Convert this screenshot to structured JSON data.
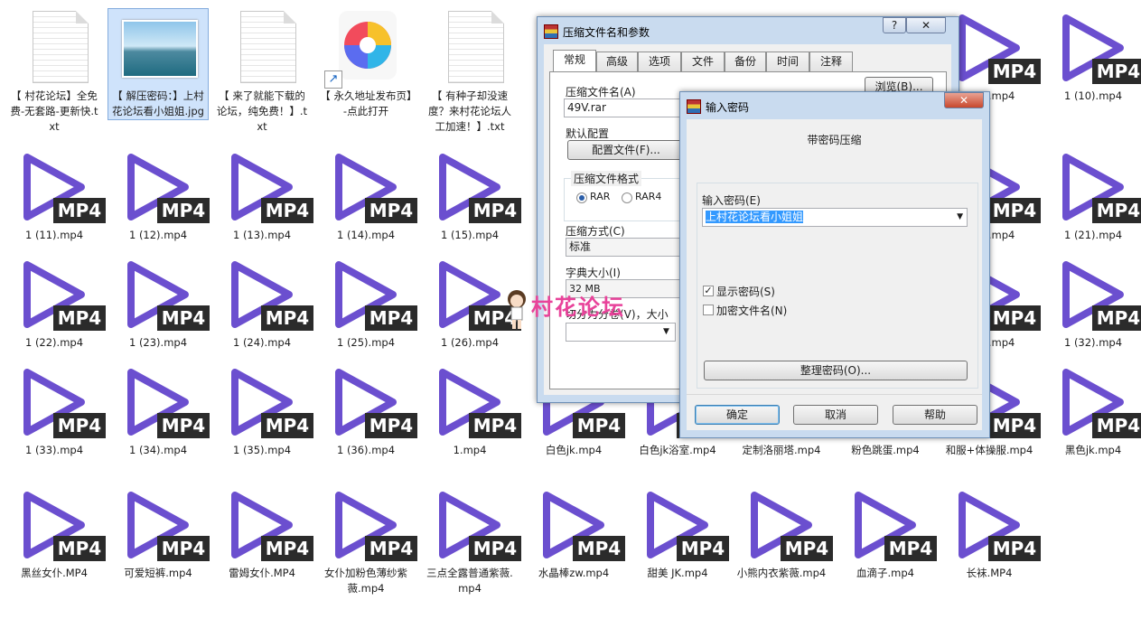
{
  "desktop": {
    "files": [
      {
        "name": "【 村花论坛】全免费-无套路-更新快.txt",
        "type": "txt"
      },
      {
        "name": "【 解压密码：】上村花论坛看小姐姐.jpg",
        "type": "jpg",
        "selected": true
      },
      {
        "name": "【 来了就能下载的论坛，纯免费！】.txt",
        "type": "txt"
      },
      {
        "name": "【 永久地址发布页】-点此打开",
        "type": "url"
      },
      {
        "name": "【 有种子却没速度？来村花论坛人工加速！】.txt",
        "type": "txt"
      },
      {
        "name": "",
        "type": "mp4",
        "hidden": true
      },
      {
        "name": "",
        "type": "mp4",
        "hidden": true
      },
      {
        "name": "",
        "type": "mp4",
        "hidden": true
      },
      {
        "name": "",
        "type": "mp4",
        "hidden": true
      },
      {
        "name": "1 (1).mp4",
        "type": "mp4",
        "partial": "mp4"
      },
      {
        "name": "1 (10).mp4",
        "type": "mp4"
      },
      {
        "name": "1 (11).mp4",
        "type": "mp4"
      },
      {
        "name": "1 (12).mp4",
        "type": "mp4"
      },
      {
        "name": "1 (13).mp4",
        "type": "mp4"
      },
      {
        "name": "1 (14).mp4",
        "type": "mp4"
      },
      {
        "name": "1 (15).mp4",
        "type": "mp4"
      },
      {
        "name": "",
        "type": "mp4",
        "hidden": true
      },
      {
        "name": "",
        "type": "mp4",
        "hidden": true
      },
      {
        "name": "",
        "type": "mp4",
        "hidden": true
      },
      {
        "name": "",
        "type": "mp4",
        "hidden": true
      },
      {
        "name": "1 (2).mp4",
        "type": "mp4",
        "partial": "mp4"
      },
      {
        "name": "1 (21).mp4",
        "type": "mp4"
      },
      {
        "name": "1 (22).mp4",
        "type": "mp4"
      },
      {
        "name": "1 (23).mp4",
        "type": "mp4"
      },
      {
        "name": "1 (24).mp4",
        "type": "mp4"
      },
      {
        "name": "1 (25).mp4",
        "type": "mp4"
      },
      {
        "name": "1 (26).mp4",
        "type": "mp4"
      },
      {
        "name": "",
        "type": "mp4",
        "hidden": true
      },
      {
        "name": "",
        "type": "mp4",
        "hidden": true
      },
      {
        "name": "",
        "type": "mp4",
        "hidden": true
      },
      {
        "name": "",
        "type": "mp4",
        "hidden": true
      },
      {
        "name": "1 (3).mp4",
        "type": "mp4",
        "partial": "mp4"
      },
      {
        "name": "1 (32).mp4",
        "type": "mp4"
      },
      {
        "name": "1 (33).mp4",
        "type": "mp4"
      },
      {
        "name": "1 (34).mp4",
        "type": "mp4"
      },
      {
        "name": "1 (35).mp4",
        "type": "mp4"
      },
      {
        "name": "1 (36).mp4",
        "type": "mp4"
      },
      {
        "name": "1.mp4",
        "type": "mp4"
      },
      {
        "name": "白色jk.mp4",
        "type": "mp4"
      },
      {
        "name": "白色jk浴室.mp4",
        "type": "mp4"
      },
      {
        "name": "定制洛丽塔.mp4",
        "type": "mp4"
      },
      {
        "name": "粉色跳蛋.mp4",
        "type": "mp4"
      },
      {
        "name": "和服+体操服.mp4",
        "type": "mp4"
      },
      {
        "name": "黑色jk.mp4",
        "type": "mp4"
      },
      {
        "name": "黑丝女仆.MP4",
        "type": "mp4"
      },
      {
        "name": "可爱短裤.mp4",
        "type": "mp4"
      },
      {
        "name": "雷姆女仆.MP4",
        "type": "mp4"
      },
      {
        "name": "女仆加粉色薄纱紫薇.mp4",
        "type": "mp4"
      },
      {
        "name": "三点全露普通紫薇.mp4",
        "type": "mp4"
      },
      {
        "name": "水晶棒zw.mp4",
        "type": "mp4"
      },
      {
        "name": "甜美 JK.mp4",
        "type": "mp4"
      },
      {
        "name": "小熊内衣紫薇.mp4",
        "type": "mp4"
      },
      {
        "name": "血滴子.mp4",
        "type": "mp4"
      },
      {
        "name": "长袜.MP4",
        "type": "mp4"
      }
    ],
    "mp4_badge": "MP4",
    "play_color": "#6b4fcf"
  },
  "archive_dialog": {
    "title": "压缩文件名和参数",
    "help_btn": "?",
    "close_btn": "✕",
    "tabs": [
      "常规",
      "高级",
      "选项",
      "文件",
      "备份",
      "时间",
      "注释"
    ],
    "archive_name_label": "压缩文件名(A)",
    "archive_name_value": "49V.rar",
    "browse_btn": "浏览(B)...",
    "profile_label": "默认配置",
    "profile_btn": "配置文件(F)...",
    "format_label": "压缩文件格式",
    "format_rar": "RAR",
    "format_rar4": "RAR4",
    "method_label": "压缩方式(C)",
    "method_value": "标准",
    "dict_label": "字典大小(I)",
    "dict_value": "32 MB",
    "split_label": "切分为分卷(V)，大小"
  },
  "password_dialog": {
    "title": "输入密码",
    "close_btn": "✕",
    "heading": "带密码压缩",
    "password_label": "输入密码(E)",
    "password_value": "上村花论坛看小姐姐",
    "show_password_label": "显示密码(S)",
    "show_password_checked": true,
    "encrypt_names_label": "加密文件名(N)",
    "encrypt_names_checked": false,
    "organize_btn": "整理密码(O)...",
    "ok_btn": "确定",
    "cancel_btn": "取消",
    "help_btn": "帮助"
  },
  "watermark": {
    "text": "村花论坛",
    "color": "#e8439a"
  }
}
